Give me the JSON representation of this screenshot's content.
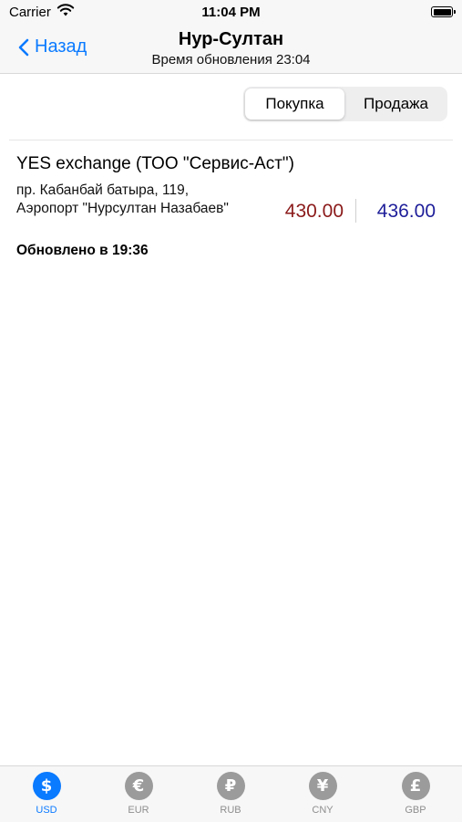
{
  "status_bar": {
    "carrier": "Carrier",
    "time": "11:04 PM"
  },
  "nav": {
    "back_label": "Назад",
    "title": "Нур-Султан",
    "subtitle": "Время обновления 23:04"
  },
  "segmented": {
    "buy_label": "Покупка",
    "sell_label": "Продажа",
    "selected": "buy"
  },
  "exchanges": [
    {
      "name": "YES exchange (ТОО \"Сервис-Аст\")",
      "address": "пр. Кабанбай батыра, 119, Аэропорт \"Нурсултан Назабаев\"",
      "updated": "Обновлено в 19:36",
      "buy": "430.00",
      "sell": "436.00"
    }
  ],
  "colors": {
    "accent": "#0a7aff",
    "buy_rate": "#8b1a1a",
    "sell_rate": "#1e1e9a",
    "inactive_tab": "#9b9b9b"
  },
  "tabs": [
    {
      "label": "USD",
      "symbol": "$",
      "icon": "dollar-icon",
      "active": true
    },
    {
      "label": "EUR",
      "symbol": "€",
      "icon": "euro-icon",
      "active": false
    },
    {
      "label": "RUB",
      "symbol": "₽",
      "icon": "ruble-icon",
      "active": false
    },
    {
      "label": "CNY",
      "symbol": "¥",
      "icon": "yuan-icon",
      "active": false
    },
    {
      "label": "GBP",
      "symbol": "£",
      "icon": "pound-icon",
      "active": false
    }
  ]
}
